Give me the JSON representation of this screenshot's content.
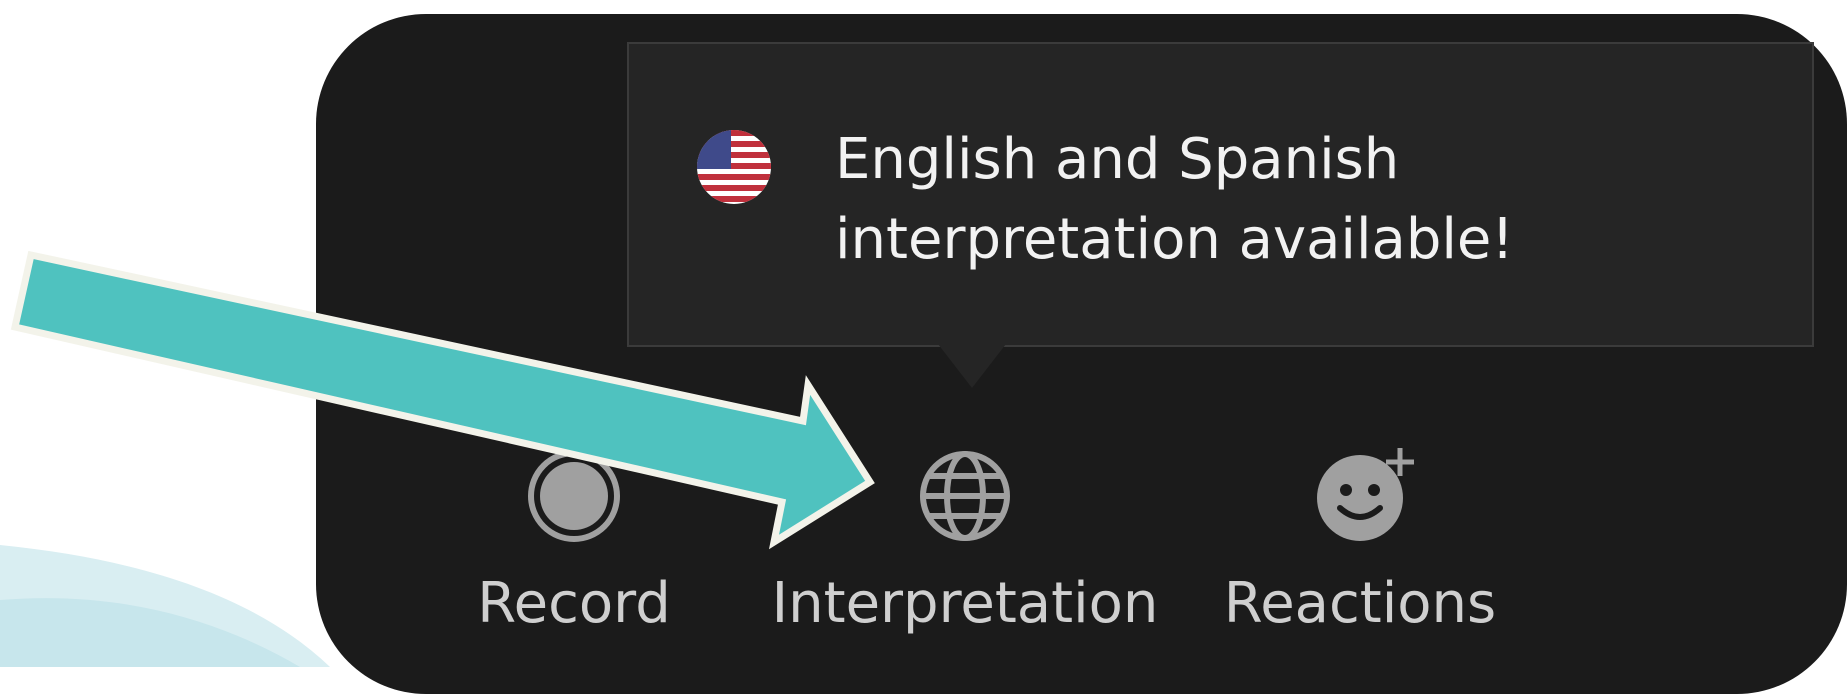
{
  "colors": {
    "toolbar_bg": "#1b1b1b",
    "tooltip_bg": "#252525",
    "icon_gray": "#a0a0a0",
    "arrow_teal": "#4fc2bf",
    "text_light": "#f2f2f2"
  },
  "tooltip": {
    "line1": "English and Spanish",
    "line2": "interpretation available!",
    "icon": "us-flag-icon"
  },
  "toolbar": {
    "buttons": [
      {
        "label": "Record",
        "icon": "record-icon"
      },
      {
        "label": "Interpretation",
        "icon": "globe-icon"
      },
      {
        "label": "Reactions",
        "icon": "emoji-add-icon"
      }
    ]
  },
  "annotation": {
    "icon": "pointer-arrow-icon"
  }
}
